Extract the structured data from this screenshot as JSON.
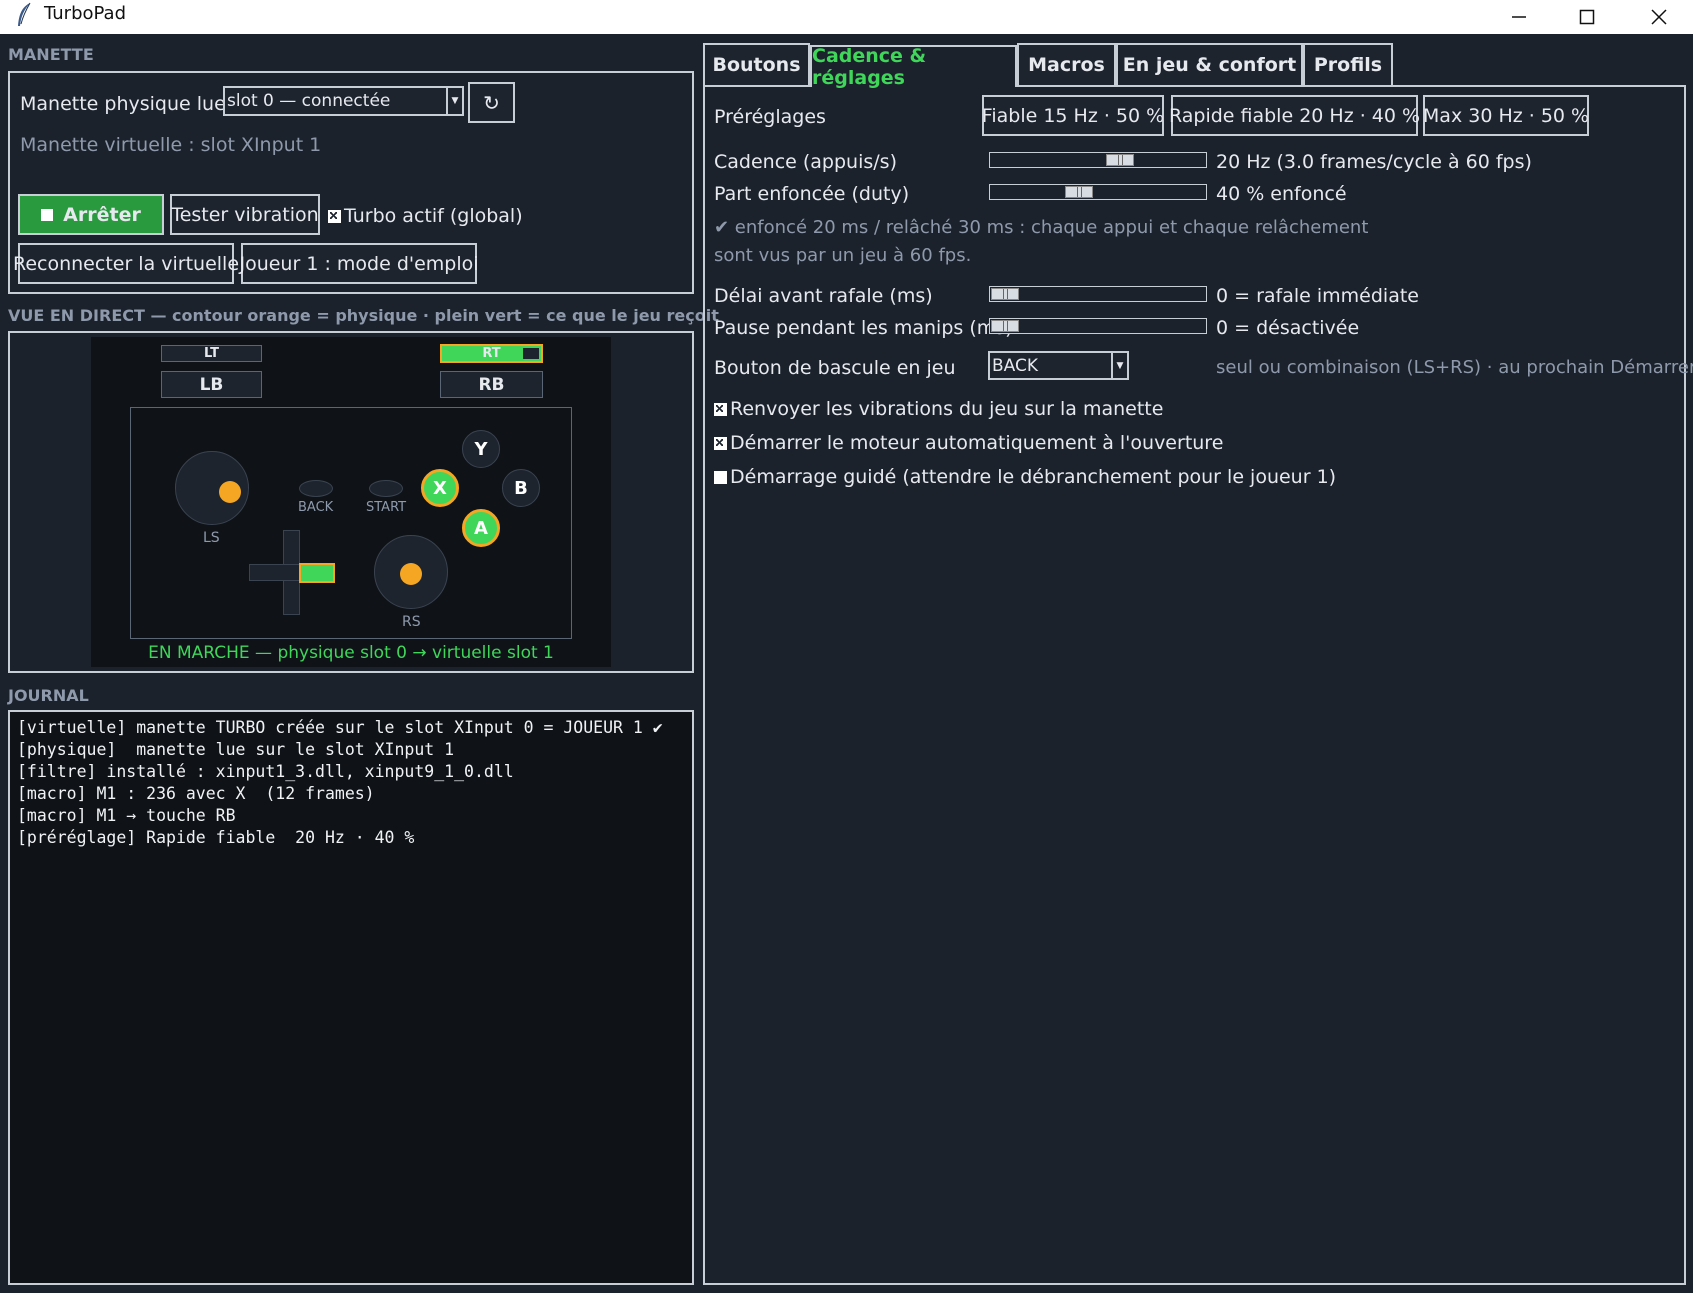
{
  "window": {
    "title": "TurboPad"
  },
  "left": {
    "manette_title": "MANETTE",
    "physical_label": "Manette physique lue :",
    "physical_value": "slot 0 — connectée",
    "refresh_glyph": "↻",
    "virtual_text": "Manette virtuelle : slot XInput 1",
    "stop_label": "Arrêter",
    "vibrate_label": "Tester vibration",
    "turbo_label": "Turbo actif (global)",
    "reconnect_label": "Reconnecter la virtuelle",
    "player_label": "Joueur 1 : mode d'emploi",
    "live_title": "VUE EN DIRECT  —  contour orange = physique · plein vert = ce que le jeu reçoit",
    "status_text": "EN MARCHE — physique slot 0 → virtuelle slot 1",
    "journal_title": "JOURNAL"
  },
  "controller": {
    "lt": "LT",
    "rt": "RT",
    "lb": "LB",
    "rb": "RB",
    "y": "Y",
    "b": "B",
    "x": "X",
    "a": "A",
    "back": "BACK",
    "start": "START",
    "ls": "LS",
    "rs": "RS"
  },
  "journal": [
    "[virtuelle] manette TURBO créée sur le slot XInput 0 = JOUEUR 1 ✔",
    "[physique]  manette lue sur le slot XInput 1",
    "[filtre] installé : xinput1_3.dll, xinput9_1_0.dll",
    "[macro] M1 : 236 avec X  (12 frames)",
    "[macro] M1 → touche RB",
    "[préréglage] Rapide fiable  20 Hz · 40 %"
  ],
  "tabs": [
    "Boutons",
    "Cadence & réglages",
    "Macros",
    "En jeu & confort",
    "Profils"
  ],
  "settings": {
    "presets_label": "Préréglages",
    "presets": [
      "Fiable  15 Hz · 50 %",
      "Rapide fiable  20 Hz · 40 %",
      "Max  30 Hz · 50 %"
    ],
    "cadence_label": "Cadence (appuis/s)",
    "cadence_value": "20 Hz  (3.0 frames/cycle à 60 fps)",
    "duty_label": "Part enfoncée (duty)",
    "duty_value": "40 % enfoncé",
    "info_line1": "✔ enfoncé 20 ms / relâché 30 ms : chaque appui et chaque relâchement",
    "info_line2": "sont vus par un jeu à 60 fps.",
    "delay_label": "Délai avant rafale (ms)",
    "delay_value": "0 = rafale immédiate",
    "pause_label": "Pause pendant les manips (ms)",
    "pause_value": "0 = désactivée",
    "toggle_label": "Bouton de bascule en jeu",
    "toggle_value": "BACK",
    "toggle_hint": "seul ou combinaison (LS+RS) · au prochain Démarrer",
    "cb_vibrations": "Renvoyer les vibrations du jeu sur la manette",
    "cb_autostart": "Démarrer le moteur automatiquement à l'ouverture",
    "cb_guided": "Démarrage guidé (attendre le débranchement pour le joueur 1)"
  },
  "slider_levels": {
    "cadence": 0.62,
    "duty": 0.4,
    "delay": 0.0,
    "pause": 0.0
  },
  "colors": {
    "accent_green": "#3fd65a",
    "orange": "#f5a623",
    "bg": "#1b222c"
  }
}
